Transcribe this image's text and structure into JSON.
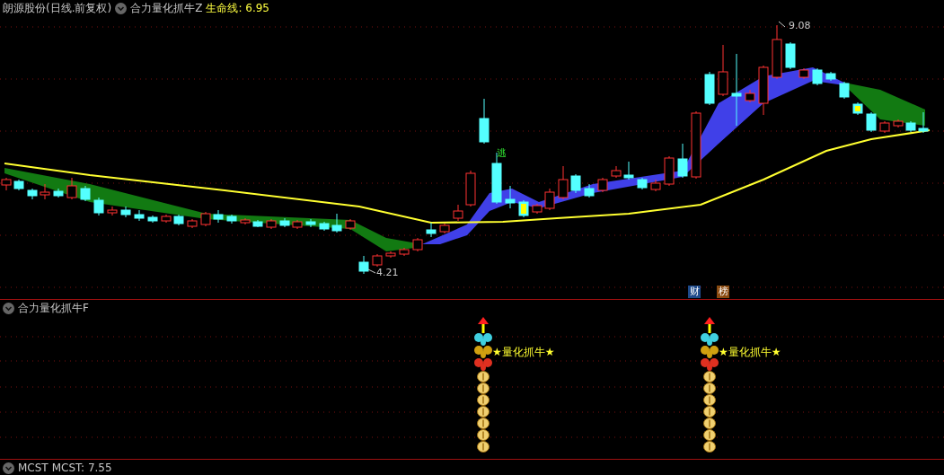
{
  "main_panel": {
    "stock": "朗源股份(日线.前复权)",
    "indicator": "合力量化抓牛Z",
    "lifeline_label": "生命线: 6.95",
    "price_high": "9.08",
    "price_low": "4.21",
    "signal_label": "逃",
    "badges": [
      {
        "text": "财",
        "color": "#1e4a8a"
      },
      {
        "text": "榜",
        "color": "#8a4a10"
      }
    ]
  },
  "sub_panel": {
    "indicator": "合力量化抓牛F",
    "signals": [
      {
        "label": "★量化抓牛★"
      },
      {
        "label": "★量化抓牛★"
      }
    ]
  },
  "bottom_panel": {
    "indicator": "MCST",
    "reading": "MCST: 7.55"
  }
}
